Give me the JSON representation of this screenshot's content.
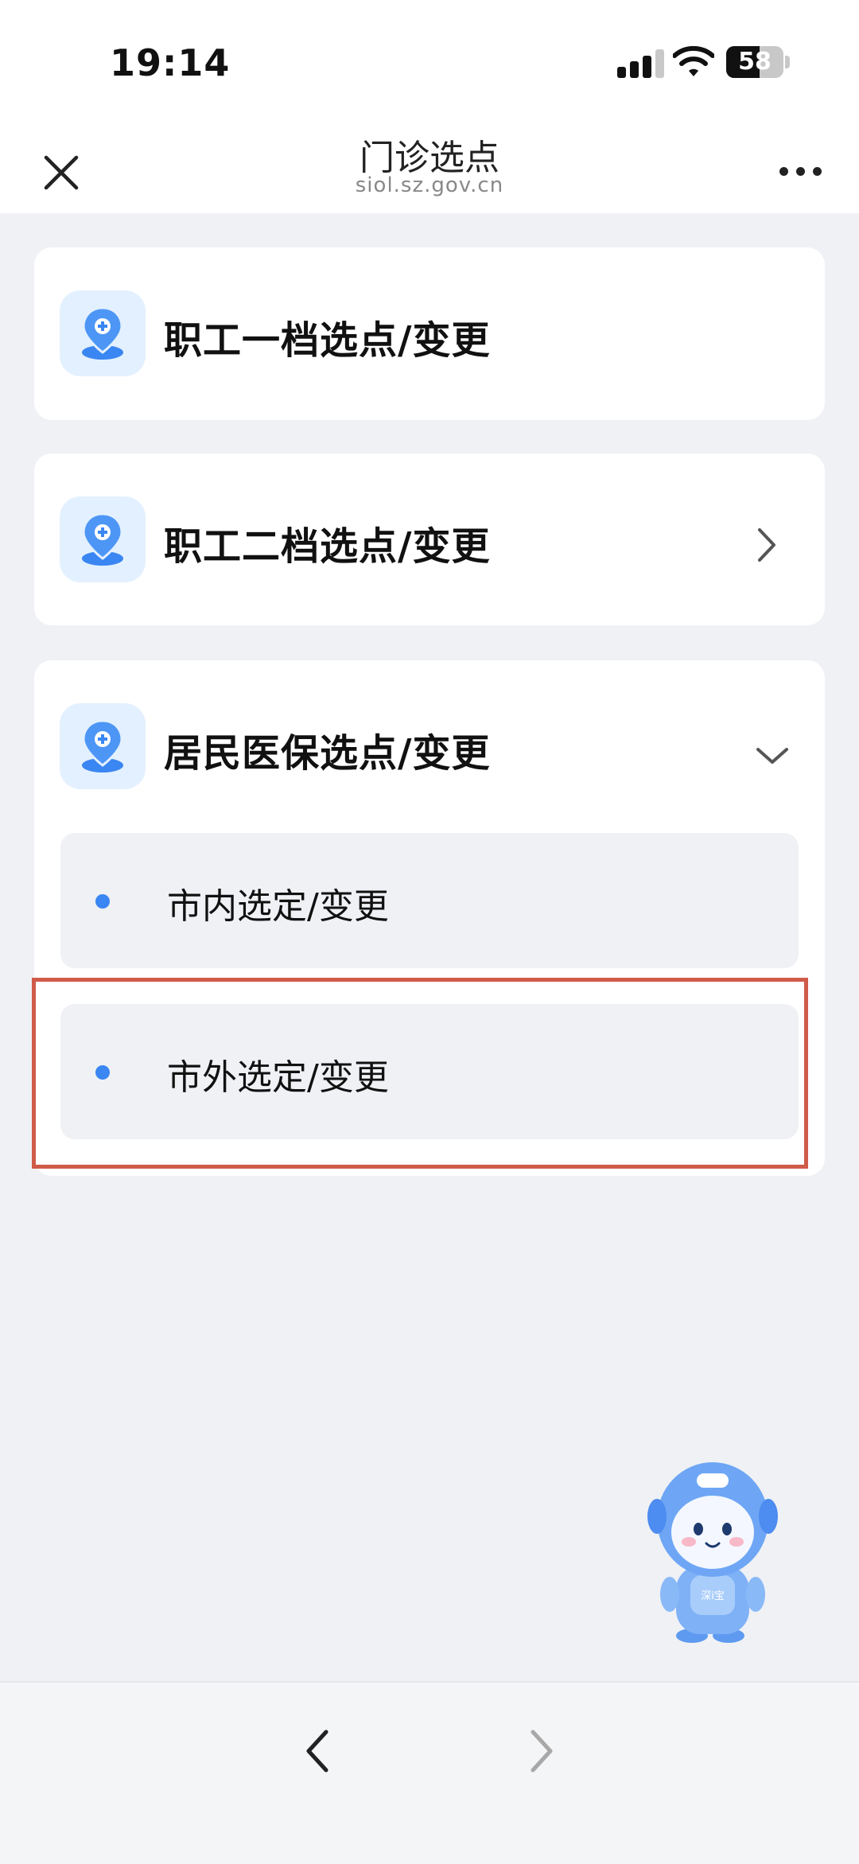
{
  "status_bar": {
    "time": "19:14",
    "battery": "58",
    "icons": [
      "signal-icon",
      "wifi-icon",
      "battery-icon"
    ]
  },
  "nav": {
    "title": "门诊选点",
    "subtitle": "siol.sz.gov.cn",
    "icons": [
      "close-icon",
      "more-icon"
    ]
  },
  "cards": [
    {
      "label": "职工一档选点/变更",
      "icon": "location-pin-icon",
      "indicator": "none"
    },
    {
      "label": "职工二档选点/变更",
      "icon": "location-pin-icon",
      "indicator": "chevron-right-icon"
    },
    {
      "label": "居民医保选点/变更",
      "icon": "location-pin-icon",
      "indicator": "chevron-down-icon",
      "expanded": true,
      "sub_items": [
        {
          "label": "市内选定/变更"
        },
        {
          "label": "市外选定/变更",
          "highlighted": true
        }
      ]
    }
  ],
  "mascot": {
    "icon": "assistant-mascot-icon"
  },
  "bottom_bar": {
    "icons": [
      "back-arrow-icon",
      "forward-arrow-icon"
    ]
  },
  "colors": {
    "accent": "#3a86f2",
    "icon_bg": "#e3f0ff",
    "page_bg": "#eff1f5",
    "highlight_border": "#cf5b48"
  }
}
